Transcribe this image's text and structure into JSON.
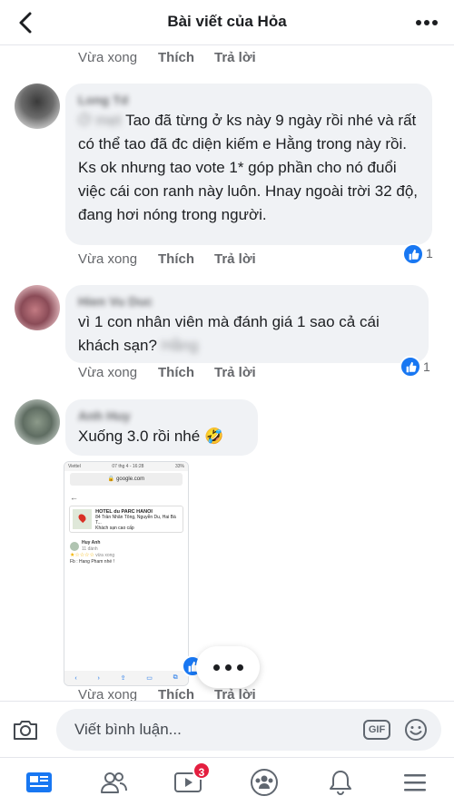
{
  "header": {
    "title": "Bài viết của Hỏa"
  },
  "actions": {
    "time": "Vừa xong",
    "like": "Thích",
    "reply": "Trả lời"
  },
  "comments": [
    {
      "name": "Long Td",
      "text_blurred_prefix": "Ở mẹt",
      "text": "Tao đã từng ở ks này 9 ngày rồi nhé và rất có thể tao đã đc diện kiếm e Hằng trong này rồi. Ks ok nhưng tao vote 1* góp phần cho nó đuổi việc cái con ranh này luôn. Hnay ngoài trời 32 độ, đang hơi nóng trong người.",
      "likes": "1"
    },
    {
      "name": "Hien Vu Duc",
      "text": "vì 1 con nhân viên mà đánh giá 1 sao cả cái khách sạn?",
      "text_blurred_suffix": "Hằng",
      "likes": "1"
    },
    {
      "name": "Anh Huy",
      "text": "Xuống 3.0 rồi nhé 🤣"
    }
  ],
  "embedded_screenshot": {
    "carrier": "Viettel",
    "time": "07 thg 4 - 16:28",
    "battery": "33%",
    "url": "google.com",
    "hotel_name": "HOTEL du PARC HANOI",
    "hotel_address": "84 Trần Nhân Tông, Nguyễn Du, Hai Bà T...",
    "hotel_type": "Khách sạn cao cấp",
    "reviewer": "Huy Anh",
    "reviewer_meta": "11 đánh",
    "review_age": "vừa xong",
    "review_text": "Fb : Hang Pham nhé !"
  },
  "composer": {
    "placeholder": "Viết bình luận...",
    "gif_label": "GIF"
  },
  "tabbar": {
    "watch_badge": "3"
  },
  "colors": {
    "accent": "#1877f2",
    "badge": "#e41e3f",
    "bubble": "#f0f2f5",
    "secondary_text": "#65676b"
  }
}
